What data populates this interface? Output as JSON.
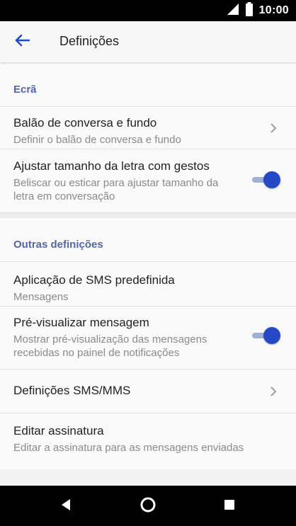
{
  "status_bar": {
    "time": "10:00",
    "icons": [
      "signal-icon",
      "battery-icon"
    ]
  },
  "app_bar": {
    "back_icon": "arrow-left-icon",
    "title": "Definições"
  },
  "sections": {
    "display": {
      "header": "Ecrã",
      "items": [
        {
          "title": "Balão de conversa e fundo",
          "subtitle": "Definir o balão de conversa e fundo",
          "control": "chevron"
        },
        {
          "title": "Ajustar tamanho da letra com gestos",
          "subtitle": "Beliscar ou esticar para ajustar tamanho da letra em conversação",
          "control": "toggle",
          "on": true
        }
      ]
    },
    "other": {
      "header": "Outras definições",
      "items": [
        {
          "title": "Aplicação de SMS predefinida",
          "subtitle": "Mensagens",
          "control": "none"
        },
        {
          "title": "Pré-visualizar mensagem",
          "subtitle": "Mostrar pré-visualização das mensagens recebidas no painel de notificações",
          "control": "toggle",
          "on": true
        },
        {
          "title": "Definições SMS/MMS",
          "subtitle": "",
          "control": "chevron"
        },
        {
          "title": "Editar assinatura",
          "subtitle": "Editar a assinatura para as mensagens enviadas",
          "control": "none"
        }
      ]
    }
  },
  "nav_bar": {
    "buttons": [
      "back-triangle-icon",
      "home-circle-icon",
      "recents-square-icon"
    ]
  },
  "colors": {
    "accent": "#2548c4",
    "section_header": "#5566a6",
    "status_bar": "#000000"
  }
}
